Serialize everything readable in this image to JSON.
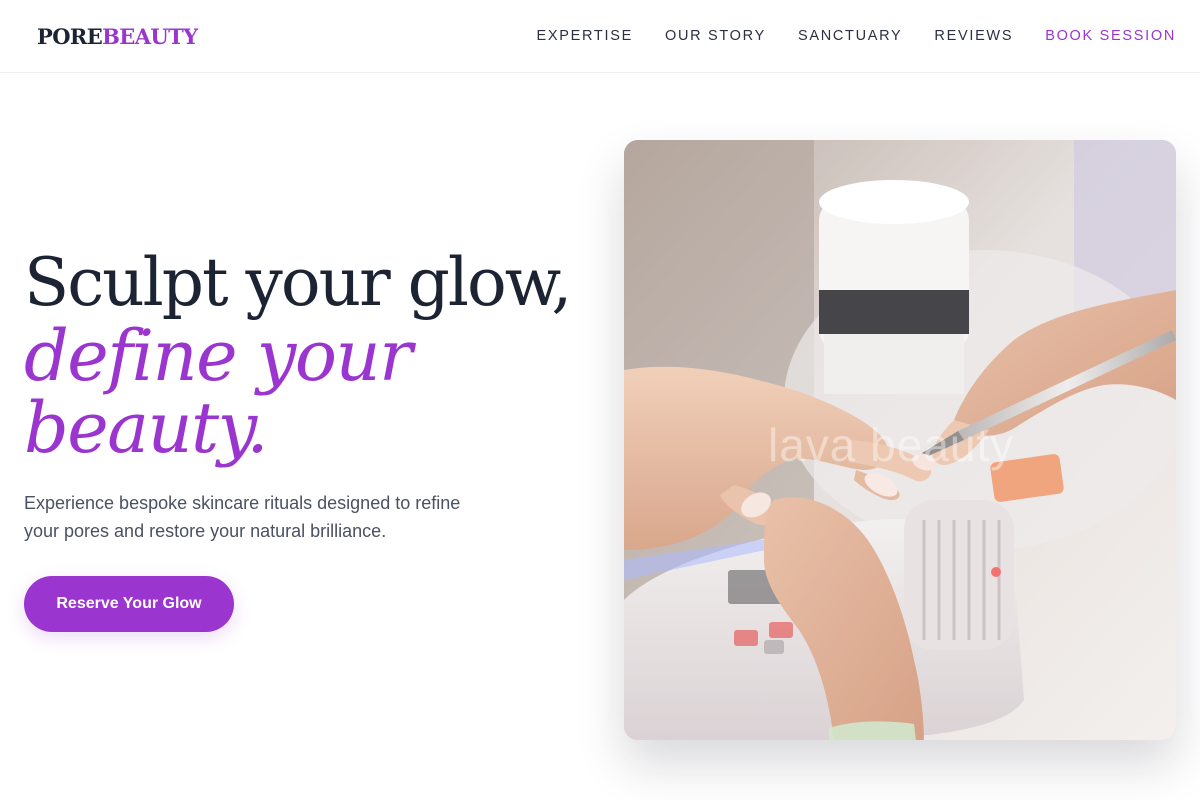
{
  "brand": {
    "logo_part1": "PORE",
    "logo_part2": "BEAUTY",
    "accent_color": "#9b35cf",
    "ink_color": "#1c2434"
  },
  "nav": {
    "items": [
      {
        "label": "EXPERTISE"
      },
      {
        "label": "OUR STORY"
      },
      {
        "label": "SANCTUARY"
      },
      {
        "label": "REVIEWS"
      }
    ],
    "cta_label": "BOOK SESSION"
  },
  "hero": {
    "title_line1": "Sculpt your glow,",
    "title_line2": "define your",
    "title_line3": "beauty.",
    "description": "Experience bespoke skincare rituals designed to refine your pores and restore your natural brilliance.",
    "button_label": "Reserve Your Glow",
    "image": {
      "alt": "Manicurist filing nails at a salon",
      "watermark_text": "lava beauty"
    }
  }
}
